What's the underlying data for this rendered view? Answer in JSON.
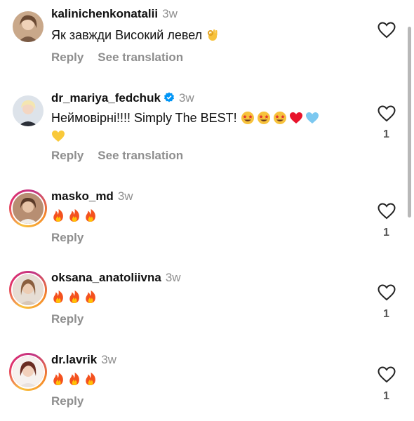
{
  "comments": [
    {
      "username": "kalinichenkonatalii",
      "time": "3w",
      "verified": false,
      "text": "Як завжди Високий левел",
      "emojis": [
        "ok-hand"
      ],
      "reply_label": "Reply",
      "translate_label": "See translation",
      "like_count": ""
    },
    {
      "username": "dr_mariya_fedchuk",
      "time": "3w",
      "verified": true,
      "text": "Неймовірні!!!! Simply The BEST!",
      "emojis": [
        "star-struck",
        "star-struck",
        "star-struck",
        "red-heart",
        "light-blue-heart",
        "yellow-heart"
      ],
      "reply_label": "Reply",
      "translate_label": "See translation",
      "like_count": "1"
    },
    {
      "username": "masko_md",
      "time": "3w",
      "verified": false,
      "text": "",
      "emojis": [
        "fire",
        "fire",
        "fire"
      ],
      "reply_label": "Reply",
      "like_count": "1"
    },
    {
      "username": "oksana_anatoliivna",
      "time": "3w",
      "verified": false,
      "text": "",
      "emojis": [
        "fire",
        "fire",
        "fire"
      ],
      "reply_label": "Reply",
      "like_count": "1"
    },
    {
      "username": "dr.lavrik",
      "time": "3w",
      "verified": false,
      "text": "",
      "emojis": [
        "fire",
        "fire",
        "fire"
      ],
      "reply_label": "Reply",
      "like_count": "1"
    }
  ],
  "colors": {
    "username": "#111111",
    "secondary": "#8e8e8e",
    "verified": "#0095f6",
    "story_ring": "#e1306c"
  },
  "icons": [
    "heart-outline-icon",
    "verified-badge-icon",
    "fire-emoji",
    "star-struck-emoji",
    "red-heart-emoji",
    "light-blue-heart-emoji",
    "yellow-heart-emoji",
    "ok-hand-emoji"
  ]
}
